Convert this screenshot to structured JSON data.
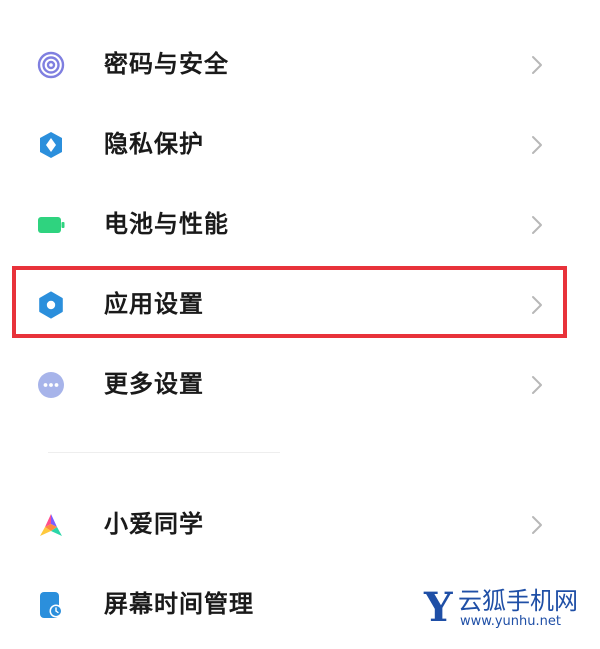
{
  "settings": {
    "items": [
      {
        "label": "密码与安全",
        "icon": "fingerprint-icon",
        "icon_color": "#7f7fe0"
      },
      {
        "label": "隐私保护",
        "icon": "shield-icon",
        "icon_color": "#2b8fdc"
      },
      {
        "label": "电池与性能",
        "icon": "battery-icon",
        "icon_color": "#2fd37f"
      },
      {
        "label": "应用设置",
        "icon": "gear-icon",
        "icon_color": "#2b8fdc"
      },
      {
        "label": "更多设置",
        "icon": "more-dots-icon",
        "icon_color": "#a7b4ea"
      },
      {
        "label": "小爱同学",
        "icon": "xiaoai-icon",
        "icon_color": "#ff4f8b"
      },
      {
        "label": "屏幕时间管理",
        "icon": "screen-time-icon",
        "icon_color": "#2b8fdc"
      }
    ],
    "highlighted_item": "应用设置",
    "highlight_color": "#e8323a"
  },
  "watermark": {
    "logo_letter": "Y",
    "name": "云狐手机网",
    "url": "www.yunhu.net",
    "color": "#1f4fa6"
  }
}
